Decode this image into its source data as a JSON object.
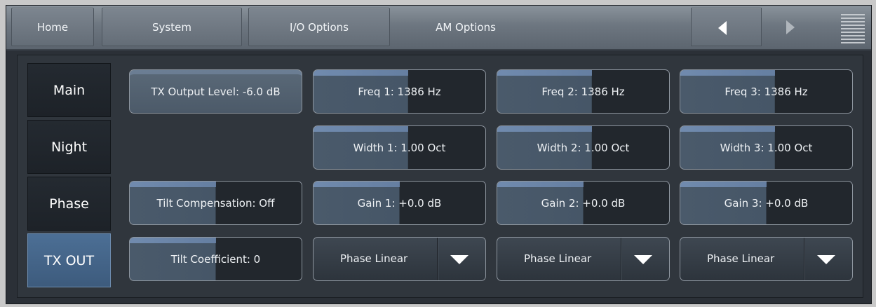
{
  "nav": {
    "tabs": [
      {
        "label": "Home"
      },
      {
        "label": "System"
      },
      {
        "label": "I/O Options"
      },
      {
        "label": "AM Options"
      }
    ]
  },
  "sidebar": {
    "items": [
      {
        "label": "Main"
      },
      {
        "label": "Night"
      },
      {
        "label": "Phase"
      },
      {
        "label": "TX OUT"
      }
    ]
  },
  "controls": {
    "tx_output_level": "TX Output Level: -6.0 dB",
    "freq1": "Freq 1: 1386 Hz",
    "freq2": "Freq 2: 1386 Hz",
    "freq3": "Freq 3: 1386 Hz",
    "width1": "Width 1: 1.00 Oct",
    "width2": "Width 2: 1.00 Oct",
    "width3": "Width 3: 1.00 Oct",
    "tilt_compensation": "Tilt Compensation: Off",
    "gain1": "Gain 1: +0.0 dB",
    "gain2": "Gain 2: +0.0 dB",
    "gain3": "Gain 3: +0.0 dB",
    "tilt_coefficient": "Tilt Coefficient: 0",
    "phase1": "Phase Linear",
    "phase2": "Phase Linear",
    "phase3": "Phase Linear"
  },
  "icons": {
    "back": "arrow-left-icon",
    "forward": "arrow-right-icon",
    "menu": "menu-grip-icon",
    "dropdown": "triangle-down-icon"
  },
  "colors": {
    "active_tab": "#46668a",
    "background": "#2b3037"
  }
}
